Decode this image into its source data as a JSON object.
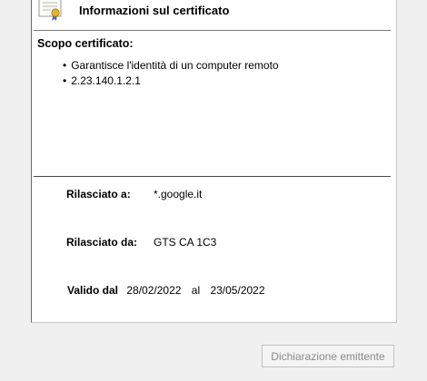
{
  "header": {
    "title": "Informazioni sul certificato",
    "icon": "certificate-icon"
  },
  "purpose": {
    "heading": "Scopo certificato:",
    "items": [
      "Garantisce l'identità di un computer remoto",
      "2.23.140.1.2.1"
    ]
  },
  "issued_to": {
    "label": "Rilasciato a:",
    "value": "*.google.it"
  },
  "issued_by": {
    "label": "Rilasciato da:",
    "value": "GTS CA 1C3"
  },
  "validity": {
    "label": "Valido dal",
    "from": "28/02/2022",
    "to_label": "al",
    "to": "23/05/2022"
  },
  "footer": {
    "issuer_statement_label": "Dichiarazione emittente"
  },
  "colors": {
    "disabled_text": "#8a8a8a",
    "border": "#7a7a7a"
  }
}
